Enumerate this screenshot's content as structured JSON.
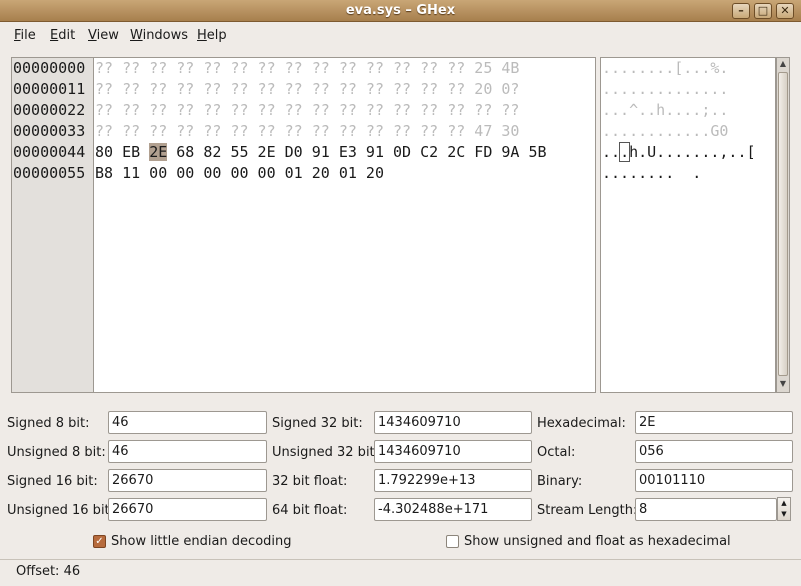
{
  "window": {
    "title": "eva.sys – GHex"
  },
  "menu": [
    {
      "label": "File",
      "ul": "F",
      "rest": "ile"
    },
    {
      "label": "Edit",
      "ul": "E",
      "rest": "dit"
    },
    {
      "label": "View",
      "ul": "V",
      "rest": "iew"
    },
    {
      "label": "Windows",
      "ul": "W",
      "rest": "indows"
    },
    {
      "label": "Help",
      "ul": "H",
      "rest": "elp"
    }
  ],
  "offsets": [
    "00000000",
    "00000011",
    "00000022",
    "00000033",
    "00000044",
    "00000055"
  ],
  "hex_rows": [
    "?? ?? ?? ?? ?? ?? ?? ?? ?? ?? ?? ?? ?? ?? 25 4B",
    "?? ?? ?? ?? ?? ?? ?? ?? ?? ?? ?? ?? ?? ?? 20 0?",
    "?? ?? ?? ?? ?? ?? ?? ?? ?? ?? ?? ?? ?? ?? ?? ??",
    "?? ?? ?? ?? ?? ?? ?? ?? ?? ?? ?? ?? ?? ?? 47 30",
    {
      "before": "80 EB ",
      "cursor": "2E",
      "after": " 68 82 55 2E D0 91 E3 91 0D C2 2C FD 9A 5B"
    },
    "B8 11 00 00 00 00 00 01 20 01 20"
  ],
  "ascii_rows": [
    "........[...%.",
    "..............",
    "...^..h....;..",
    "............G0",
    {
      "before": "..",
      "cursor": ".",
      "after": "h.U.......,..["
    },
    "........  ."
  ],
  "fields": {
    "signed8": {
      "label": "Signed 8 bit:",
      "value": "46"
    },
    "unsigned8": {
      "label": "Unsigned 8 bit:",
      "value": "46"
    },
    "signed16": {
      "label": "Signed 16 bit:",
      "value": "26670"
    },
    "unsigned16": {
      "label": "Unsigned 16 bit:",
      "value": "26670"
    },
    "signed32": {
      "label": "Signed 32 bit:",
      "value": "1434609710"
    },
    "unsigned32": {
      "label": "Unsigned 32 bit:",
      "value": "1434609710"
    },
    "float32": {
      "label": "32 bit float:",
      "value": "1.792299e+13"
    },
    "float64": {
      "label": "64 bit float:",
      "value": "-4.302488e+171"
    },
    "hexadecimal": {
      "label": "Hexadecimal:",
      "value": "2E"
    },
    "octal": {
      "label": "Octal:",
      "value": "056"
    },
    "binary": {
      "label": "Binary:",
      "value": "00101110"
    },
    "stream_length": {
      "label": "Stream Length:",
      "value": "8"
    }
  },
  "options": {
    "little_endian": {
      "label": "Show little endian decoding",
      "checked": true
    },
    "unsigned_hex": {
      "label": "Show unsigned and float as hexadecimal",
      "checked": false
    }
  },
  "status": {
    "offset_text": "Offset: 46"
  },
  "colors": {
    "titlebar": "#b58e5d",
    "cursor_byte": "#b1a090",
    "checkbox_checked": "#b76b3d"
  }
}
